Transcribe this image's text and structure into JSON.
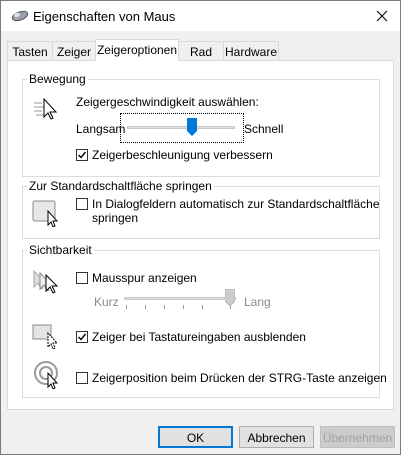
{
  "window": {
    "title": "Eigenschaften von Maus"
  },
  "tabs": [
    {
      "label": "Tasten"
    },
    {
      "label": "Zeiger"
    },
    {
      "label": "Zeigeroptionen"
    },
    {
      "label": "Rad"
    },
    {
      "label": "Hardware"
    }
  ],
  "active_tab": "Zeigeroptionen",
  "motion": {
    "group_title": "Bewegung",
    "speed_label": "Zeigergeschwindigkeit auswählen:",
    "slow_label": "Langsam",
    "fast_label": "Schnell",
    "speed_level": 0.6,
    "enhance_precision_label": "Zeigerbeschleunigung verbessern",
    "enhance_precision_checked": true
  },
  "snap": {
    "group_title": "Zur Standardschaltfläche springen",
    "label_line1": "In Dialogfeldern automatisch zur Standardschaltfläche",
    "label_line2": "springen",
    "checked": false
  },
  "visibility": {
    "group_title": "Sichtbarkeit",
    "trails_label": "Mausspur anzeigen",
    "trails_checked": false,
    "short_label": "Kurz",
    "long_label": "Lang",
    "trails_level": 1.0,
    "hide_typing_label": "Zeiger bei Tastatureingaben ausblenden",
    "hide_typing_checked": true,
    "show_ctrl_label": "Zeigerposition beim Drücken der STRG-Taste anzeigen",
    "show_ctrl_checked": false
  },
  "buttons": {
    "ok": "OK",
    "cancel": "Abbrechen",
    "apply": "Übernehmen"
  }
}
